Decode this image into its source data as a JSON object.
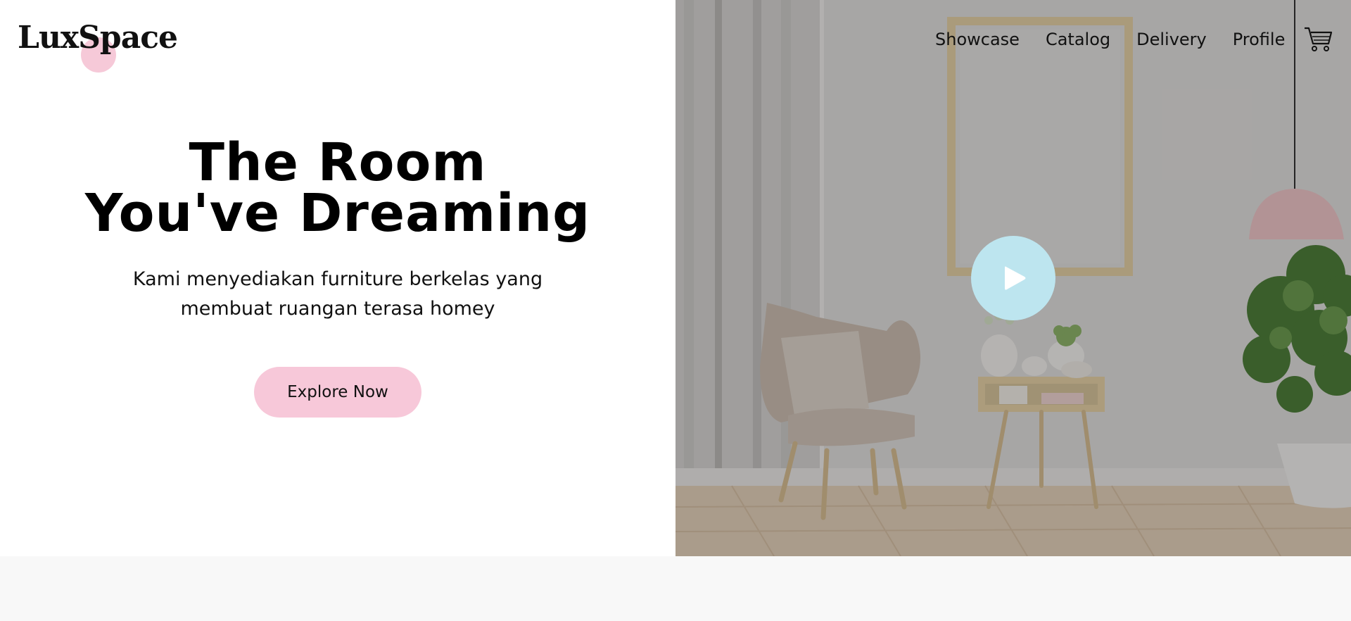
{
  "brand": {
    "logo_text": "LuxSpace"
  },
  "nav": {
    "items": [
      {
        "label": "Showcase"
      },
      {
        "label": "Catalog"
      },
      {
        "label": "Delivery"
      },
      {
        "label": "Profile"
      }
    ],
    "cart_icon": "cart-icon"
  },
  "hero": {
    "title_line1": "The Room",
    "title_line2": "You've Dreaming",
    "subtitle_line1": "Kami menyediakan furniture berkelas yang",
    "subtitle_line2": "membuat ruangan terasa homey",
    "cta_label": "Explore Now"
  },
  "media": {
    "play_icon": "play-icon"
  },
  "colors": {
    "accent_pink": "#f7c8d9",
    "play_blue": "#bde5ef",
    "footer_bg": "#f8f8f8"
  }
}
